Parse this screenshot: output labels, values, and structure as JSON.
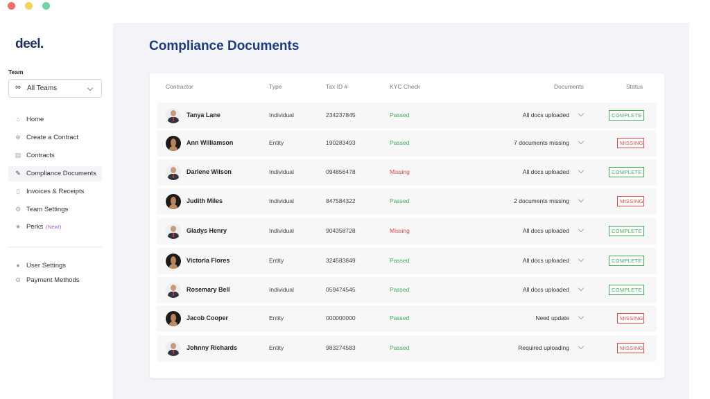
{
  "colors": {
    "brand": "#1c2b5a",
    "title": "#1c3a80",
    "passed": "#3bab5a",
    "missing": "#e04848",
    "new_badge": "#a45bd1"
  },
  "window_controls": [
    "close",
    "minimize",
    "maximize"
  ],
  "sidebar": {
    "logo": "deel.",
    "team_label": "Team",
    "team_select": {
      "icon": "infinity-icon",
      "value": "All Teams"
    },
    "items": [
      {
        "label": "Home",
        "icon": "home-icon"
      },
      {
        "label": "Create a Contract",
        "icon": "plus-circle-icon"
      },
      {
        "label": "Contracts",
        "icon": "contract-icon"
      },
      {
        "label": "Compliance Documents",
        "icon": "pen-icon",
        "active": true
      },
      {
        "label": "Invoices & Receipts",
        "icon": "receipt-icon"
      },
      {
        "label": "Team Settings",
        "icon": "gear-icon"
      },
      {
        "label": "Perks",
        "icon": "star-icon",
        "badge": "(New!)"
      }
    ],
    "bottom_items": [
      {
        "label": "User Settings",
        "icon": "user-icon"
      },
      {
        "label": "Payment Methods",
        "icon": "gear-icon"
      }
    ]
  },
  "main": {
    "title": "Compliance Documents",
    "table": {
      "headers": {
        "contractor": "Contractor",
        "type": "Type",
        "tax_id": "Tax ID #",
        "kyc": "KYC Check",
        "documents": "Documents",
        "status": "Status"
      },
      "rows": [
        {
          "name": "Tanya Lane",
          "avatar": "suit",
          "type": "Individual",
          "tax_id": "234237845",
          "kyc": "Passed",
          "documents": "All docs uploaded",
          "status": "COMPLETE"
        },
        {
          "name": "Ann Williamson",
          "avatar": "dark",
          "type": "Entity",
          "tax_id": "190283493",
          "kyc": "Passed",
          "documents": "7 documents missing",
          "status": "MISSING"
        },
        {
          "name": "Darlene Wilson",
          "avatar": "suit",
          "type": "Individual",
          "tax_id": "094856478",
          "kyc": "Missing",
          "documents": "All docs uploaded",
          "status": "COMPLETE"
        },
        {
          "name": "Judith Miles",
          "avatar": "dark",
          "type": "Individual",
          "tax_id": "847584322",
          "kyc": "Passed",
          "documents": "2 documents missing",
          "status": "MISSING"
        },
        {
          "name": "Gladys Henry",
          "avatar": "suit",
          "type": "Individual",
          "tax_id": "904358728",
          "kyc": "Missing",
          "documents": "All docs uploaded",
          "status": "COMPLETE"
        },
        {
          "name": "Victoria Flores",
          "avatar": "dark",
          "type": "Entity",
          "tax_id": "324583849",
          "kyc": "Passed",
          "documents": "All docs uploaded",
          "status": "COMPLETE"
        },
        {
          "name": "Rosemary Bell",
          "avatar": "suit",
          "type": "Individual",
          "tax_id": "059474545",
          "kyc": "Passed",
          "documents": "All docs uploaded",
          "status": "COMPLETE"
        },
        {
          "name": "Jacob Cooper",
          "avatar": "dark",
          "type": "Entity",
          "tax_id": "000000000",
          "kyc": "Passed",
          "documents": "Need update",
          "status": "MISSING"
        },
        {
          "name": "Johnny Richards",
          "avatar": "suit",
          "type": "Entity",
          "tax_id": "983274583",
          "kyc": "Passed",
          "documents": "Required uploading",
          "status": "MISSING"
        }
      ]
    }
  }
}
